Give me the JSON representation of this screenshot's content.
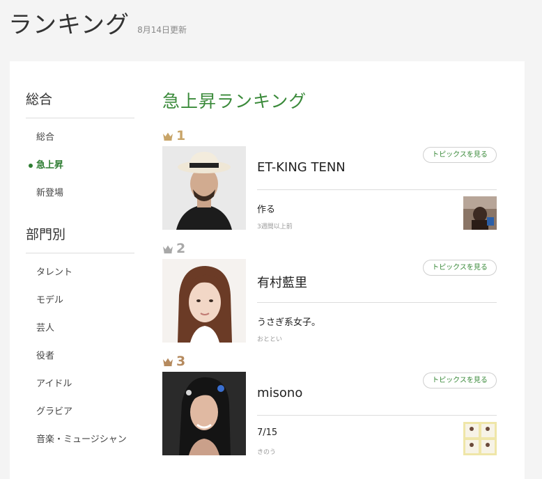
{
  "header": {
    "title": "ランキング",
    "updated": "8月14日更新"
  },
  "sidebar": {
    "sections": [
      {
        "heading": "総合",
        "items": [
          {
            "label": "総合",
            "active": false
          },
          {
            "label": "急上昇",
            "active": true
          },
          {
            "label": "新登場",
            "active": false
          }
        ]
      },
      {
        "heading": "部門別",
        "items": [
          {
            "label": "タレント",
            "active": false
          },
          {
            "label": "モデル",
            "active": false
          },
          {
            "label": "芸人",
            "active": false
          },
          {
            "label": "役者",
            "active": false
          },
          {
            "label": "アイドル",
            "active": false
          },
          {
            "label": "グラビア",
            "active": false
          },
          {
            "label": "音楽・ミュージシャン",
            "active": false
          }
        ]
      }
    ]
  },
  "main": {
    "title": "急上昇ランキング",
    "topics_button_label": "トピックスを見る",
    "entries": [
      {
        "rank": "1",
        "crown_color": "#c8a468",
        "name": "ET-KING TENN",
        "topic": "作る",
        "time": "3週間以上前",
        "has_topic_thumb": true
      },
      {
        "rank": "2",
        "crown_color": "#a8a8a8",
        "name": "有村藍里",
        "topic": "うさぎ系女子。",
        "time": "おととい",
        "has_topic_thumb": false
      },
      {
        "rank": "3",
        "crown_color": "#b58a5e",
        "name": "misono",
        "topic": "7/15",
        "time": "きのう",
        "has_topic_thumb": true
      }
    ]
  },
  "colors": {
    "accent": "#3a8a3a",
    "background": "#f4f4f4"
  }
}
